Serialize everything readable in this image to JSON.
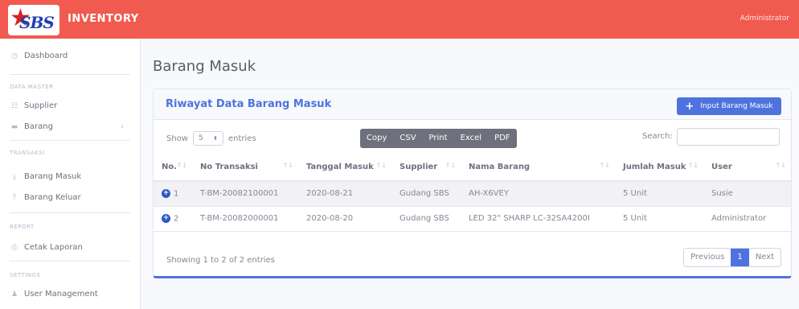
{
  "app": {
    "brand": "INVENTORY",
    "logo_text": "SBS",
    "user": "Administrator"
  },
  "sidebar": {
    "dashboard": "Dashboard",
    "sections": [
      "DATA MASTER",
      "TRANSAKSI",
      "REPORT",
      "SETTINGS"
    ],
    "items": {
      "supplier": "Supplier",
      "barang": "Barang",
      "barang_masuk": "Barang Masuk",
      "barang_keluar": "Barang Keluar",
      "cetak_laporan": "Cetak Laporan",
      "user_management": "User Management"
    }
  },
  "page": {
    "title": "Barang Masuk"
  },
  "card": {
    "title": "Riwayat Data Barang Masuk",
    "add_button": "Input Barang Masuk",
    "show_label": "Show",
    "show_value": "5",
    "entries_label": "entries",
    "export_buttons": [
      "Copy",
      "CSV",
      "Print",
      "Excel",
      "PDF"
    ],
    "search_label": "Search:",
    "search_value": ""
  },
  "table": {
    "columns": [
      "No.",
      "No Transaksi",
      "Tanggal Masuk",
      "Supplier",
      "Nama Barang",
      "Jumlah Masuk",
      "User"
    ],
    "rows": [
      [
        "1",
        "T-BM-20082100001",
        "2020-08-21",
        "Gudang SBS",
        "AH-X6VEY",
        "5 Unit",
        "Susie"
      ],
      [
        "2",
        "T-BM-20082000001",
        "2020-08-20",
        "Gudang SBS",
        "LED 32\" SHARP LC-32SA4200I",
        "5 Unit",
        "Administrator"
      ]
    ]
  },
  "footer": {
    "info": "Showing 1 to 2 of 2 entries",
    "previous": "Previous",
    "page": "1",
    "next": "Next"
  }
}
